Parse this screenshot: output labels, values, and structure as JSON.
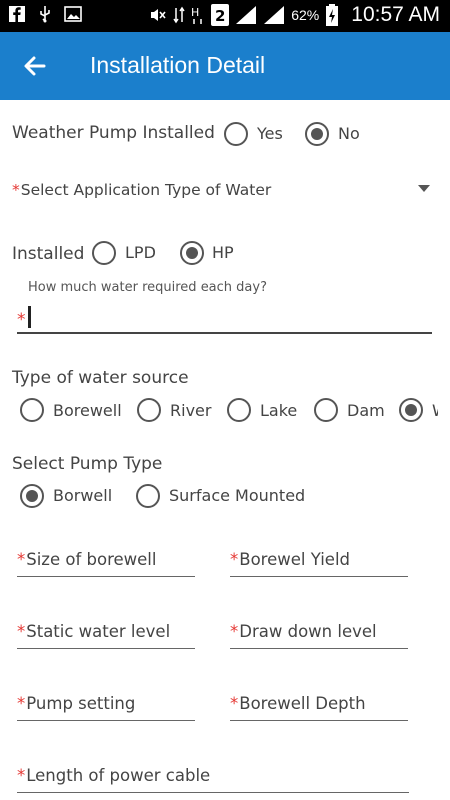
{
  "status_bar": {
    "battery": "62%",
    "time": "10:57 AM"
  },
  "app_bar": {
    "title": "Installation Detail"
  },
  "pump_installed": {
    "label": "Weather Pump Installed",
    "options": [
      "Yes",
      "No"
    ],
    "selected": "No"
  },
  "application_type": {
    "required": "*",
    "label": "Select Application Type of Water"
  },
  "installed": {
    "label": "Installed",
    "options": [
      "LPD",
      "HP"
    ],
    "selected": "HP"
  },
  "water_required": {
    "hint": "How much water required each day?",
    "required": "*",
    "value": ""
  },
  "water_source": {
    "label": "Type of water source",
    "options": [
      "Borewell",
      "River",
      "Lake",
      "Dam",
      "W"
    ],
    "selected": "W"
  },
  "pump_type": {
    "label": "Select Pump Type",
    "options": [
      "Borwell",
      "Surface Mounted"
    ],
    "selected": "Borwell"
  },
  "fields": {
    "size_of_borewell": "Size of borewell",
    "borewell_yield": "Borewel Yield",
    "static_water_level": "Static water level",
    "draw_down_level": "Draw down level",
    "pump_setting": "Pump setting",
    "borewell_depth": "Borewell Depth",
    "length_of_power_cable": "Length of power cable",
    "required_mark": "*"
  }
}
